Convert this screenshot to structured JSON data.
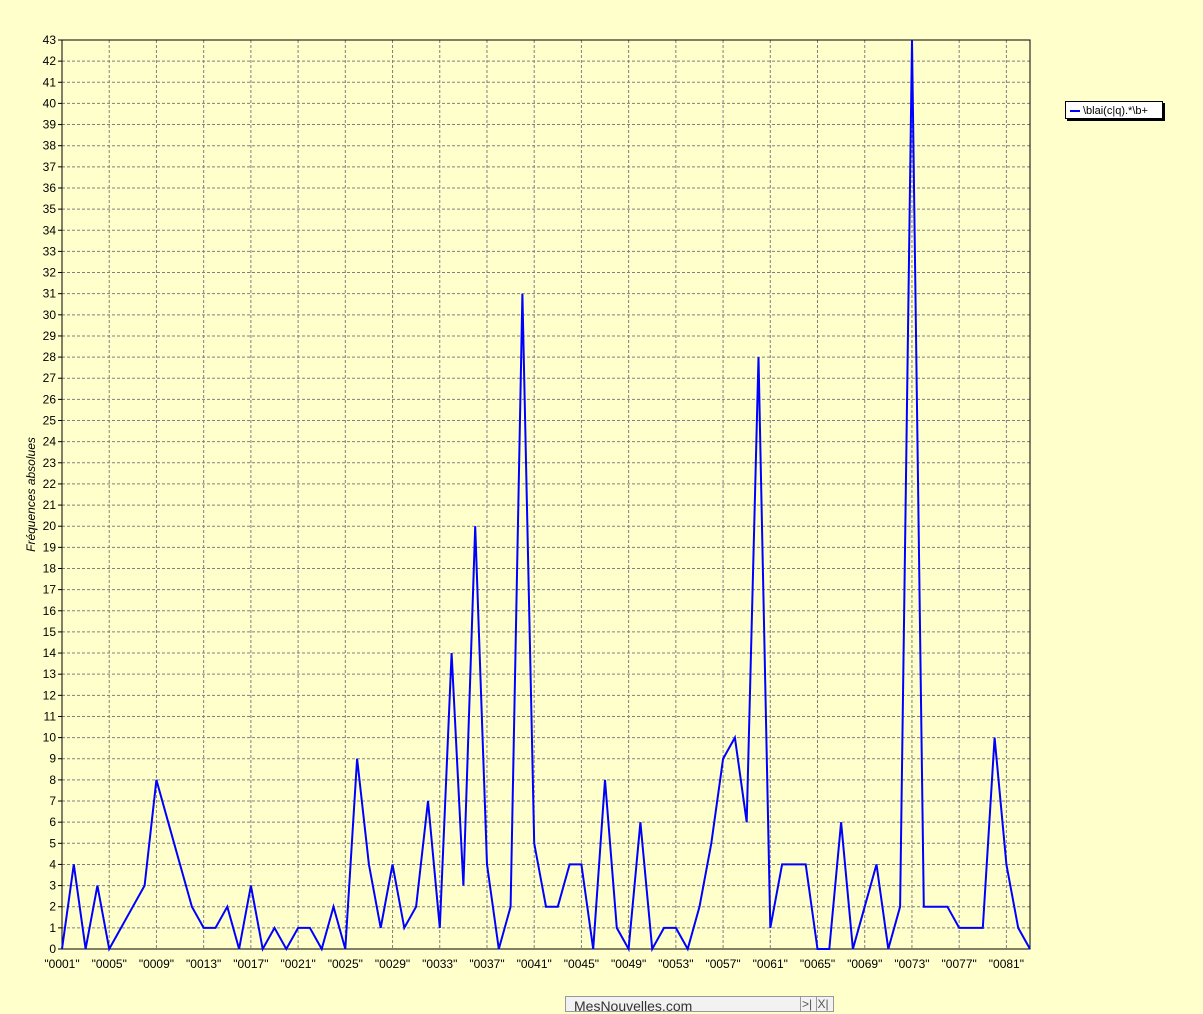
{
  "chart_data": {
    "type": "line",
    "xlabel": "",
    "ylabel": "Fréquences absolues",
    "ylim": [
      0,
      43
    ],
    "grid": true,
    "legend_position": "right",
    "x_tick_labels": [
      "\"0001\"",
      "\"0005\"",
      "\"0009\"",
      "\"0013\"",
      "\"0017\"",
      "\"0021\"",
      "\"0025\"",
      "\"0029\"",
      "\"0033\"",
      "\"0037\"",
      "\"0041\"",
      "\"0045\"",
      "\"0049\"",
      "\"0053\"",
      "\"0057\"",
      "\"0061\"",
      "\"0065\"",
      "\"0069\"",
      "\"0073\"",
      "\"0077\"",
      "\"0081\""
    ],
    "series": [
      {
        "name": "\\blai(c|q).*\\b+",
        "color": "#0000ff",
        "values": [
          0,
          4,
          0,
          3,
          0,
          1,
          2,
          3,
          8,
          6,
          4,
          2,
          1,
          1,
          2,
          0,
          3,
          0,
          1,
          0,
          1,
          1,
          0,
          2,
          0,
          9,
          4,
          1,
          4,
          1,
          2,
          7,
          1,
          14,
          3,
          20,
          4,
          0,
          2,
          31,
          5,
          2,
          2,
          4,
          4,
          0,
          8,
          1,
          0,
          6,
          0,
          1,
          1,
          0,
          2,
          5,
          9,
          10,
          6,
          28,
          1,
          4,
          4,
          4,
          0,
          0,
          6,
          0,
          2,
          4,
          0,
          2,
          43,
          2,
          2,
          2,
          1,
          1,
          1,
          10,
          4,
          1,
          0
        ]
      }
    ]
  },
  "banner": {
    "label": "MesNouvelles.com",
    "next_label": ">|",
    "close_label": "X|"
  }
}
